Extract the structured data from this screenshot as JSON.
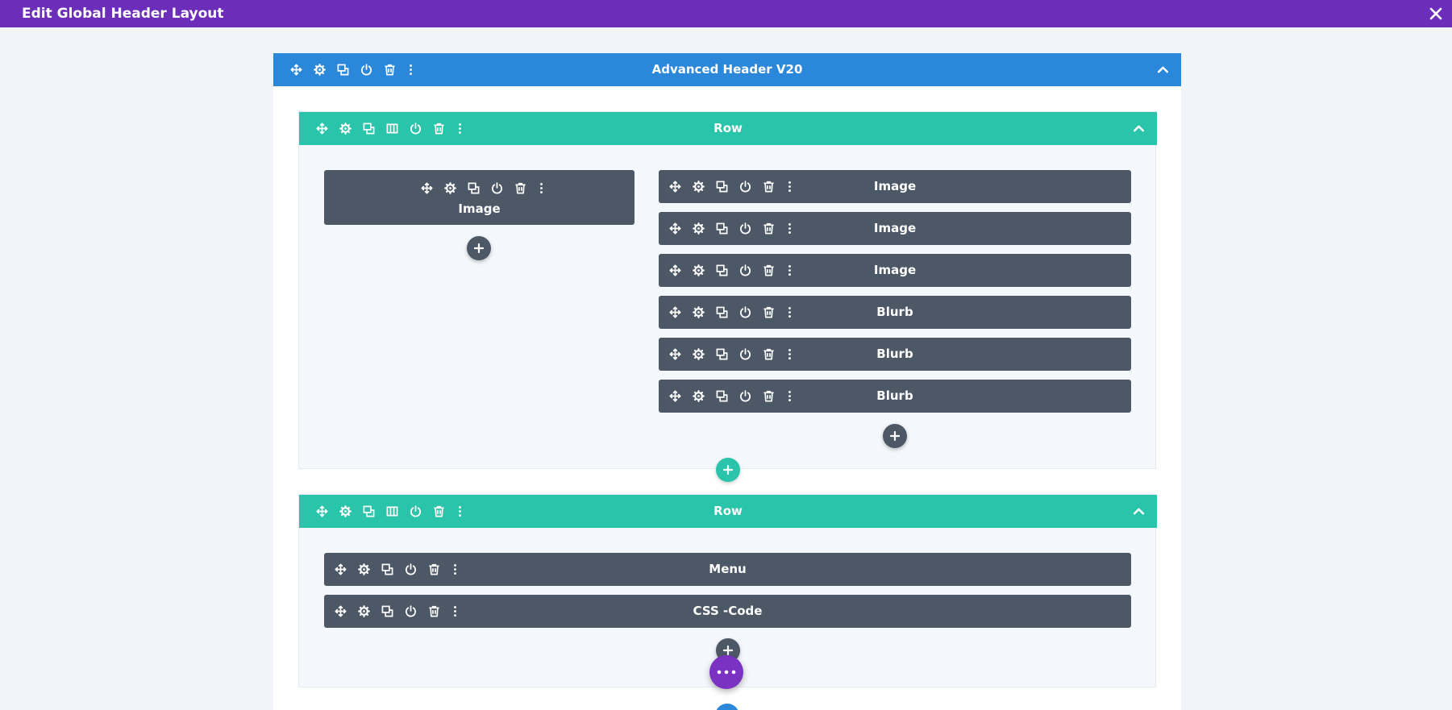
{
  "window": {
    "title": "Edit Global Header Layout",
    "close_icon": "close-icon"
  },
  "colors": {
    "topbar": "#6c2eb9",
    "section": "#2b87da",
    "row": "#29c4a9",
    "module": "#4c5866",
    "fab": "#7b32c2"
  },
  "section": {
    "title": "Advanced Header V20"
  },
  "rows": [
    {
      "title": "Row",
      "columns": [
        {
          "modules": [
            {
              "title": "Image"
            }
          ]
        },
        {
          "modules": [
            {
              "title": "Image"
            },
            {
              "title": "Image"
            },
            {
              "title": "Image"
            },
            {
              "title": "Blurb"
            },
            {
              "title": "Blurb"
            },
            {
              "title": "Blurb"
            }
          ]
        }
      ]
    },
    {
      "title": "Row",
      "columns": [
        {
          "modules": [
            {
              "title": "Menu"
            },
            {
              "title": "CSS -Code"
            }
          ]
        }
      ]
    }
  ],
  "icons": {
    "section_tools": [
      "move-icon",
      "gear-icon",
      "duplicate-icon",
      "power-icon",
      "trash-icon",
      "more-icon"
    ],
    "row_tools": [
      "move-icon",
      "gear-icon",
      "duplicate-icon",
      "columns-icon",
      "power-icon",
      "trash-icon",
      "more-icon"
    ],
    "module_tools": [
      "move-icon",
      "gear-icon",
      "duplicate-icon",
      "power-icon",
      "trash-icon",
      "more-icon"
    ]
  }
}
